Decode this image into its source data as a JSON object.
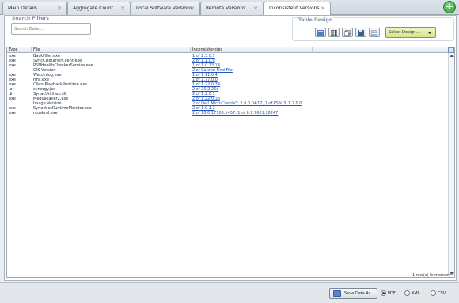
{
  "tabs": [
    {
      "label": "Main Details",
      "active": false
    },
    {
      "label": "Aggregate Count",
      "active": false
    },
    {
      "label": "Local Software Versions",
      "active": false
    },
    {
      "label": "Remote Versions",
      "active": false
    },
    {
      "label": "Inconsistent Versions",
      "active": true
    }
  ],
  "add_tab_icon": "plus-icon",
  "filters": {
    "title": "Search Filters",
    "search_placeholder": "Search Data...."
  },
  "table_design": {
    "title": "Table Design",
    "buttons": [
      "auto-fit-columns-icon",
      "columns-icon",
      "copy-icon",
      "save-layout-icon",
      "clear-filter-icon"
    ],
    "select_value": "Select Design...."
  },
  "table": {
    "columns": [
      "Type",
      "File",
      "Inconsistencies"
    ],
    "rows": [
      {
        "type": "exe",
        "file": "BackFiller.exe",
        "inconsistencies": "1 of 2.3.0.7"
      },
      {
        "type": "exe",
        "file": "SyncCDBurnerClient.exe",
        "inconsistencies": "2 of 1.1.0.0"
      },
      {
        "type": "exe",
        "file": "PSNHealthCheckerService.exe",
        "inconsistencies": "1 of 1.0.13.14"
      },
      {
        "type": "",
        "file": "GIS Version",
        "inconsistencies": "2 of Cannot Find File"
      },
      {
        "type": "exe",
        "file": "Watchdog.exe",
        "inconsistencies": "1 of 1.11.0.4"
      },
      {
        "type": "exe",
        "file": "rms.exe",
        "inconsistencies": "1 of 1.77.0.0"
      },
      {
        "type": "exe",
        "file": "ClientPlaybackRuntime.exe",
        "inconsistencies": "1 of 1.22.0.34"
      },
      {
        "type": "jar",
        "file": "synergy.jar",
        "inconsistencies": "2 of 20.2.26e"
      },
      {
        "type": "dll",
        "file": "SynacUtilities.dll",
        "inconsistencies": "2 of 1.2.6.1"
      },
      {
        "type": "exe",
        "file": "MediaPlayer2.exe",
        "inconsistencies": "2 of 1.22.0.38"
      },
      {
        "type": "",
        "file": "Image Version",
        "inconsistencies": "2 of Dell_MicroClientV2_2.0.0.0#17, 1 of PSN_3_1.2.0.0"
      },
      {
        "type": "exe",
        "file": "SynecticsRuntimeMonitor.exe",
        "inconsistencies": "2 of 1.0.1.2"
      },
      {
        "type": "exe",
        "file": "ntoskrnl.exe",
        "inconsistencies": "2 of 10.0.17763.1457, 1 of 6.1.7601.18247"
      }
    ],
    "row_count_text": "1 row(s) in memory"
  },
  "bottom": {
    "save_label": "Save Data As",
    "formats": [
      {
        "label": "PDF",
        "selected": true
      },
      {
        "label": "XML",
        "selected": false
      },
      {
        "label": "CSV",
        "selected": false
      }
    ]
  },
  "colors": {
    "link": "#2456b8",
    "select_bg": "#d8e38a",
    "add_button": "#2e9b36"
  }
}
